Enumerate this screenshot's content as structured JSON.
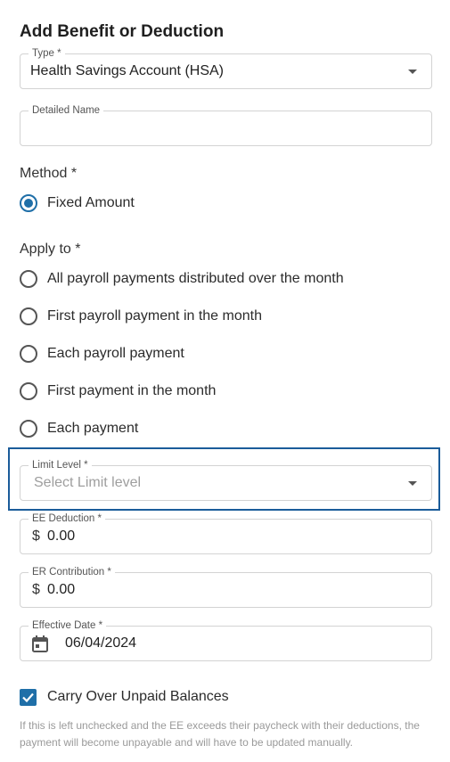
{
  "title": "Add Benefit or Deduction",
  "type_field": {
    "label": "Type *",
    "value": "Health Savings Account (HSA)"
  },
  "detailed_name": {
    "label": "Detailed Name",
    "value": ""
  },
  "method": {
    "label": "Method *",
    "options": [
      {
        "label": "Fixed Amount",
        "checked": true
      }
    ]
  },
  "apply_to": {
    "label": "Apply to *",
    "options": [
      {
        "label": "All payroll payments distributed over the month",
        "checked": false
      },
      {
        "label": "First payroll payment in the month",
        "checked": false
      },
      {
        "label": "Each payroll payment",
        "checked": false
      },
      {
        "label": "First payment in the month",
        "checked": false
      },
      {
        "label": "Each payment",
        "checked": false
      }
    ]
  },
  "limit_level": {
    "label": "Limit Level *",
    "placeholder": "Select Limit level"
  },
  "ee_deduction": {
    "label": "EE Deduction *",
    "currency": "$",
    "value": "0.00"
  },
  "er_contribution": {
    "label": "ER Contribution *",
    "currency": "$",
    "value": "0.00"
  },
  "effective_date": {
    "label": "Effective Date *",
    "value": "06/04/2024"
  },
  "carry_over": {
    "label": "Carry Over Unpaid Balances",
    "checked": true,
    "note": "If this is left unchecked and the EE exceeds their paycheck with their deductions, the payment will become unpayable and will have to be updated manually."
  },
  "colors": {
    "accent": "#1f6fa8",
    "highlight_border": "#1b5c9a"
  }
}
